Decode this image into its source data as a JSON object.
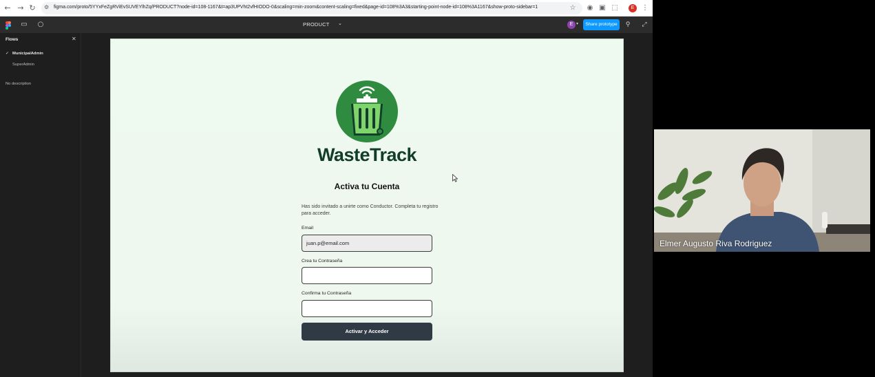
{
  "browser": {
    "url": "figma.com/proto/5YYxFeZgRViEvSUVEYlhZq/PRODUCT?node-id=108-1167&t=ap3UPVht2vfHIODO-0&scaling=min-zoom&content-scaling=fixed&page-id=108%3A3&starting-point-node-id=108%3A1167&show-proto-sidebar=1",
    "profile_initial": "E"
  },
  "figma": {
    "page_name": "PRODUCT",
    "user_initial": "E",
    "share_label": "Share prototype"
  },
  "sidebar": {
    "title": "Flows",
    "flows": [
      "MunicipalAdmin",
      "SuperAdmin"
    ],
    "description": "No description"
  },
  "screen": {
    "brand": "WasteTrack",
    "heading": "Activa tu Cuenta",
    "description": "Has sido invitado a unirte como Conductor. Completa tu registro para acceder.",
    "email_label": "Email",
    "email_value": "juan.p@email.com",
    "password_label": "Crea tu Contraseña",
    "confirm_label": "Confirma tu Contraseña",
    "submit_label": "Activar y Acceder"
  },
  "webcam": {
    "name": "Elmer Augusto Riva Rodriguez"
  },
  "colors": {
    "brand_green": "#2e8b3f",
    "brand_text": "#123d2b",
    "share_blue": "#0d99ff",
    "button_dark": "#2f3a45"
  }
}
